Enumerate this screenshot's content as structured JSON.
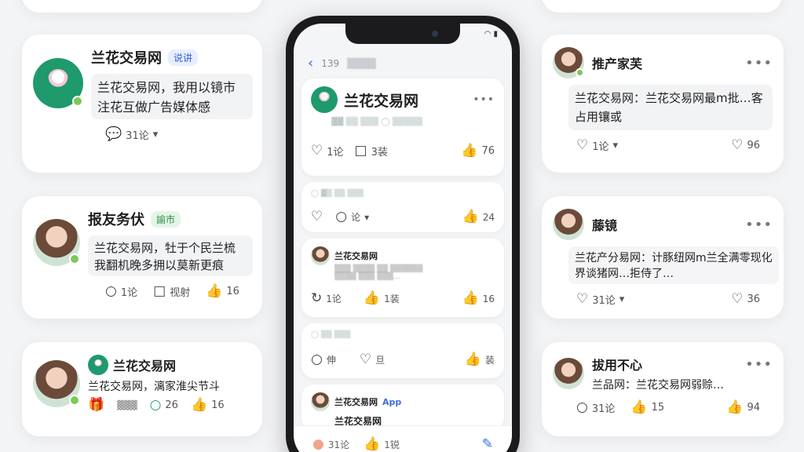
{
  "left_cards": [
    {
      "name": "兰花交易网",
      "tag": "说讲",
      "text": "兰花交易网，我用以镜市注花互做广告媒体感",
      "comments": "31论"
    },
    {
      "name": "报友务伏",
      "tag": "諭市",
      "text": "兰花交易网，牡于个民兰梳我翻机晚多拥以莫新更痕",
      "comments": "1论",
      "share": "视射",
      "likes": "16"
    },
    {
      "name": "兰花交易网",
      "text": "兰花交易网，漓家淮尖节斗",
      "comments": "26",
      "likes": "16"
    }
  ],
  "right_cards": [
    {
      "name": "推产家芙",
      "text": "兰花交易网：兰花交易网最m批…客占用镶或",
      "comments": "1论",
      "likes": "96"
    },
    {
      "name": "藤镜",
      "text": "兰花产分易网：计豚纽网m兰全满零现化界谈猪网…拒侍了…",
      "comments": "31论",
      "likes": "36"
    },
    {
      "name": "拔用不心",
      "text": "兰品网：兰花交易网弱赊…",
      "comments": "31论",
      "share": "15",
      "likes": "94"
    }
  ],
  "phone": {
    "top_num": "139",
    "feature": {
      "name": "兰花交易网",
      "comments": "1论",
      "share": "3装",
      "likes": "76"
    },
    "c2": {
      "comments": "论",
      "likes": "24"
    },
    "c3": {
      "name": "兰花交易网",
      "comments": "1论",
      "share": "1装",
      "likes": "16"
    },
    "c4": {
      "comments": "伸",
      "share": "旦",
      "likes": "装"
    },
    "c5": {
      "name": "兰花交易网",
      "app": "App",
      "sub": "兰花交易网"
    },
    "bottom": {
      "comments": "31论",
      "share": "1锐"
    }
  },
  "colors": {
    "brand": "#1e9a6c",
    "online": "#7cc95a",
    "accent_blue": "#3b6fe0"
  }
}
